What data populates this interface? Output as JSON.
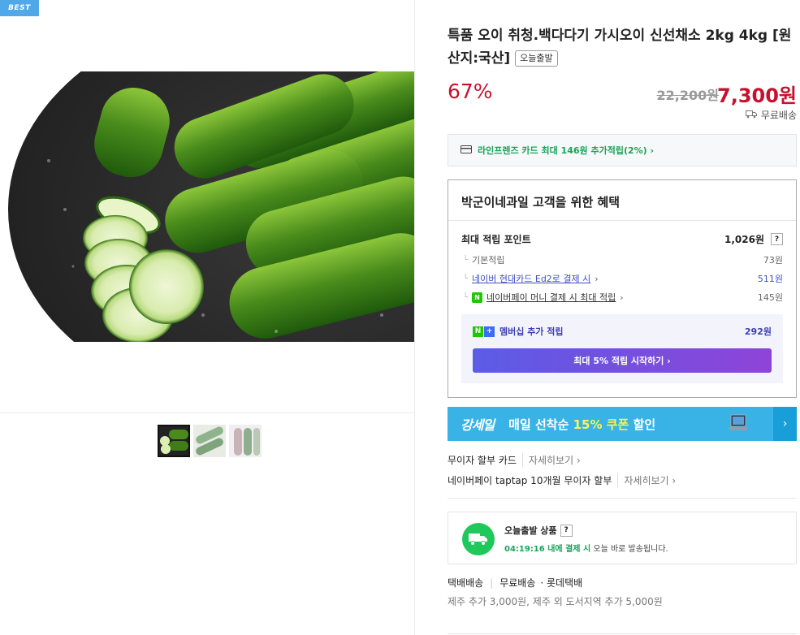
{
  "badge": "BEST",
  "product": {
    "title": "특품 오이 취청.백다다기 가시오이 신선채소 2kg 4kg [원산지:국산]",
    "tag": "오늘출발",
    "discount": "67%",
    "original_price": "22,200원",
    "sale_price": "7,300원",
    "shipping": "무료배송"
  },
  "card_promo": "라인프렌즈 카드 최대 146원 추가적립(2%) ›",
  "benefit": {
    "heading": "박군이네과일 고객을 위한 혜택",
    "max_point_label": "최대 적립 포인트",
    "max_point_value": "1,026원",
    "help": "?",
    "basic_label": "기본적립",
    "basic_value": "73원",
    "hyundai_label": "네이버 현대카드 Ed2로 결제 시",
    "hyundai_value": "511원",
    "npay_label": "네이버페이 머니 결제 시 최대 적립",
    "npay_value": "145원",
    "member_label": "멤버십 추가 적립",
    "member_value": "292원",
    "start_button": "최대 5% 적립 시작하기 ›"
  },
  "banner": {
    "logo": "강세일",
    "text_a": "매일 선착순 ",
    "text_b": "15% 쿠폰",
    "text_c": " 할인",
    "arrow": "›"
  },
  "installments": [
    {
      "label": "무이자 할부 카드",
      "more": "자세히보기 ›"
    },
    {
      "label": "네이버페이 taptap 10개월 무이자 할부",
      "more": "자세히보기 ›"
    }
  ],
  "today_ship": {
    "title": "오늘출발 상품",
    "help": "?",
    "time": "04:19:16 내에 결제 시",
    "desc": " 오늘 바로 발송됩니다."
  },
  "delivery": {
    "type": "택배배송",
    "fee": "무료배송",
    "carrier": "· 롯데택배",
    "extra": "제주 추가 3,000원, 제주 외 도서지역 추가 5,000원"
  },
  "colors": {
    "price_red": "#c8102e",
    "naver_green": "#1ec800",
    "benefit_blue": "#3e4fc1",
    "banner_blue": "#39b3e6"
  }
}
